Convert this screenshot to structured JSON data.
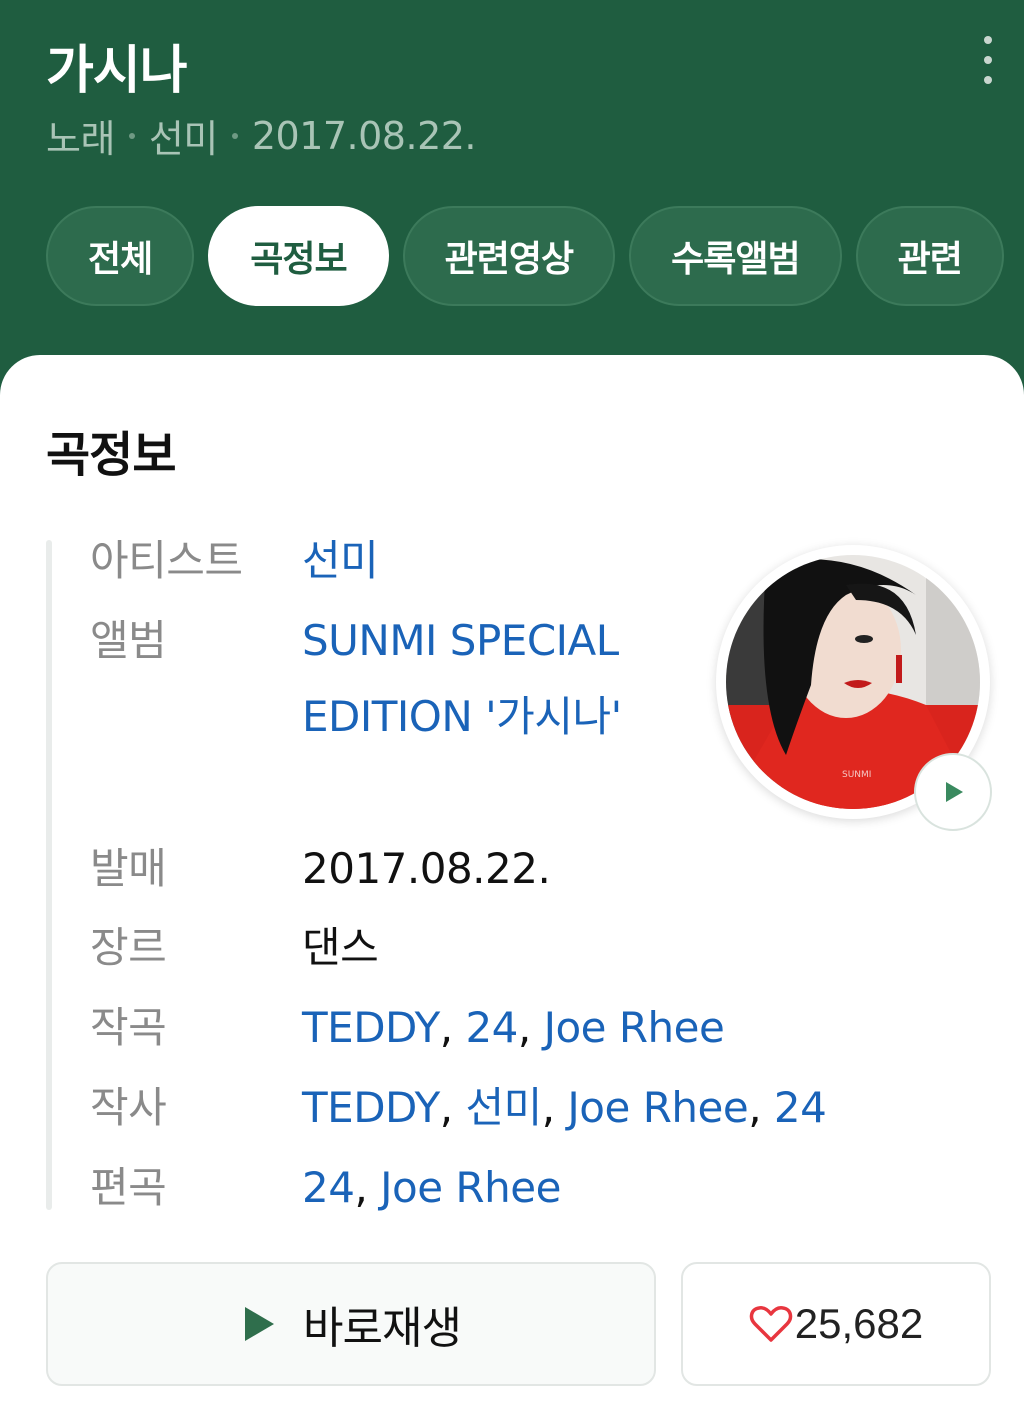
{
  "header": {
    "title": "가시나",
    "subtitle": {
      "type": "노래",
      "artist": "선미",
      "date": "2017.08.22."
    },
    "more_icon": "more-vertical-icon"
  },
  "tabs": [
    {
      "label": "전체",
      "active": false
    },
    {
      "label": "곡정보",
      "active": true
    },
    {
      "label": "관련영상",
      "active": false
    },
    {
      "label": "수록앨범",
      "active": false
    },
    {
      "label": "관련",
      "active": false
    }
  ],
  "card": {
    "title": "곡정보",
    "rows": {
      "artist": {
        "label": "아티스트",
        "value": "선미"
      },
      "album": {
        "label": "앨범",
        "value": "SUNMI SPECIAL EDITION '가시나'"
      },
      "release": {
        "label": "발매",
        "value": "2017.08.22."
      },
      "genre": {
        "label": "장르",
        "value": "댄스"
      },
      "composer": {
        "label": "작곡",
        "values": [
          "TEDDY",
          "24",
          "Joe Rhee"
        ]
      },
      "lyricist": {
        "label": "작사",
        "values": [
          "TEDDY",
          "선미",
          "Joe Rhee",
          "24"
        ]
      },
      "arranger": {
        "label": "편곡",
        "values": [
          "24",
          "Joe Rhee"
        ]
      }
    },
    "album_art_text": "SUNMI"
  },
  "actions": {
    "play_label": "바로재생",
    "like_count": "25,682"
  },
  "colors": {
    "brand_green": "#1f5d40",
    "link_blue": "#1a63b8",
    "heart_red": "#e8363f",
    "play_green": "#3a8a5f"
  }
}
